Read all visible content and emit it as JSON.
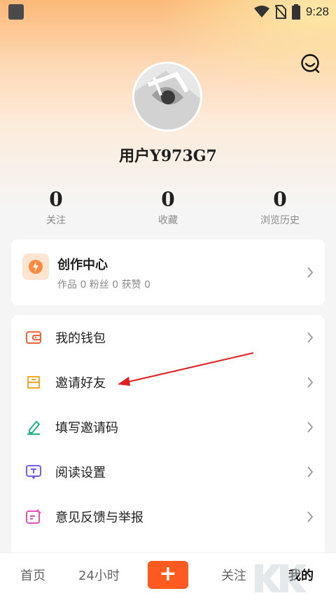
{
  "status_bar": {
    "time": "9:28"
  },
  "profile": {
    "username": "用户Y973G7"
  },
  "stats": [
    {
      "value": "0",
      "label": "关注"
    },
    {
      "value": "0",
      "label": "收藏"
    },
    {
      "value": "0",
      "label": "浏览历史"
    }
  ],
  "creator": {
    "title": "创作中心",
    "subtitle": "作品 0 粉丝 0 获赞 0"
  },
  "menu": [
    {
      "label": "我的钱包",
      "icon": "wallet-icon",
      "color": "#f0643c"
    },
    {
      "label": "邀请好友",
      "icon": "invite-icon",
      "color": "#f5a623"
    },
    {
      "label": "填写邀请码",
      "icon": "pencil-icon",
      "color": "#1fb38a"
    },
    {
      "label": "阅读设置",
      "icon": "reading-settings-icon",
      "color": "#7b5cf0"
    },
    {
      "label": "意见反馈与举报",
      "icon": "feedback-icon",
      "color": "#e84fbf"
    }
  ],
  "bottom_nav": {
    "home": "首页",
    "hours24": "24小时",
    "plus": "+",
    "follow": "关注",
    "mine": "我的"
  },
  "colors": {
    "accent": "#ff5a1f",
    "annotation_arrow": "#e02020"
  }
}
